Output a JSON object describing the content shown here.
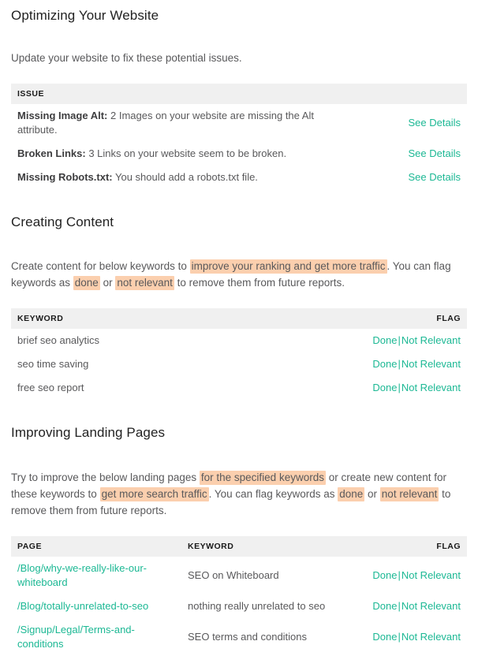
{
  "sections": [
    {
      "title": "Optimizing Your Website",
      "intro": "Update your website to fix these potential issues.",
      "table": {
        "headers": {
          "issue": "ISSUE"
        },
        "rows": [
          {
            "name": "Missing Image Alt:",
            "description": "2 Images on your website are missing the Alt attribute.",
            "action": "See Details"
          },
          {
            "name": "Broken Links:",
            "description": "3 Links on your website seem to be broken.",
            "action": "See Details"
          },
          {
            "name": "Missing Robots.txt:",
            "description": "You should add a robots.txt file.",
            "action": "See Details"
          }
        ]
      }
    },
    {
      "title": "Creating Content",
      "intro_parts": {
        "p1": "Create content for below keywords to ",
        "h1": "improve your ranking and get more traffic",
        "p2": ". You can flag keywords as ",
        "h2": "done",
        "p3": " or ",
        "h3": "not relevant",
        "p4": " to remove them from future reports."
      },
      "table": {
        "headers": {
          "keyword": "KEYWORD",
          "flag": "FLAG"
        },
        "rows": [
          {
            "keyword": "brief seo analytics",
            "done": "Done",
            "not_relevant": "Not Relevant"
          },
          {
            "keyword": "seo time saving",
            "done": "Done",
            "not_relevant": "Not Relevant"
          },
          {
            "keyword": "free seo report",
            "done": "Done",
            "not_relevant": "Not Relevant"
          }
        ]
      }
    },
    {
      "title": "Improving Landing Pages",
      "intro_parts": {
        "p1": "Try to improve the below landing pages ",
        "h1": "for the specified keywords",
        "p2": " or create new content for these keywords to ",
        "h2": "get more search traffic",
        "p3": ". You can flag keywords as ",
        "h3": "done",
        "p4": " or ",
        "h4": "not relevant",
        "p5": " to remove them from future reports."
      },
      "table": {
        "headers": {
          "page": "PAGE",
          "keyword": "KEYWORD",
          "flag": "FLAG"
        },
        "rows": [
          {
            "page": "/Blog/why-we-really-like-our-whiteboard",
            "keyword": "SEO on Whiteboard",
            "done": "Done",
            "not_relevant": "Not Relevant"
          },
          {
            "page": "/Blog/totally-unrelated-to-seo",
            "keyword": "nothing really unrelated to seo",
            "done": "Done",
            "not_relevant": "Not Relevant"
          },
          {
            "page": "/Signup/Legal/Terms-and-conditions",
            "keyword": "SEO terms and conditions",
            "done": "Done",
            "not_relevant": "Not Relevant"
          }
        ]
      }
    }
  ],
  "separator": "|",
  "colors": {
    "link_green": "#1cb894",
    "highlight_peach": "#fbcfae",
    "table_header_bg": "#f0f0f0",
    "body_text": "#59595b",
    "heading_text": "#222222"
  }
}
